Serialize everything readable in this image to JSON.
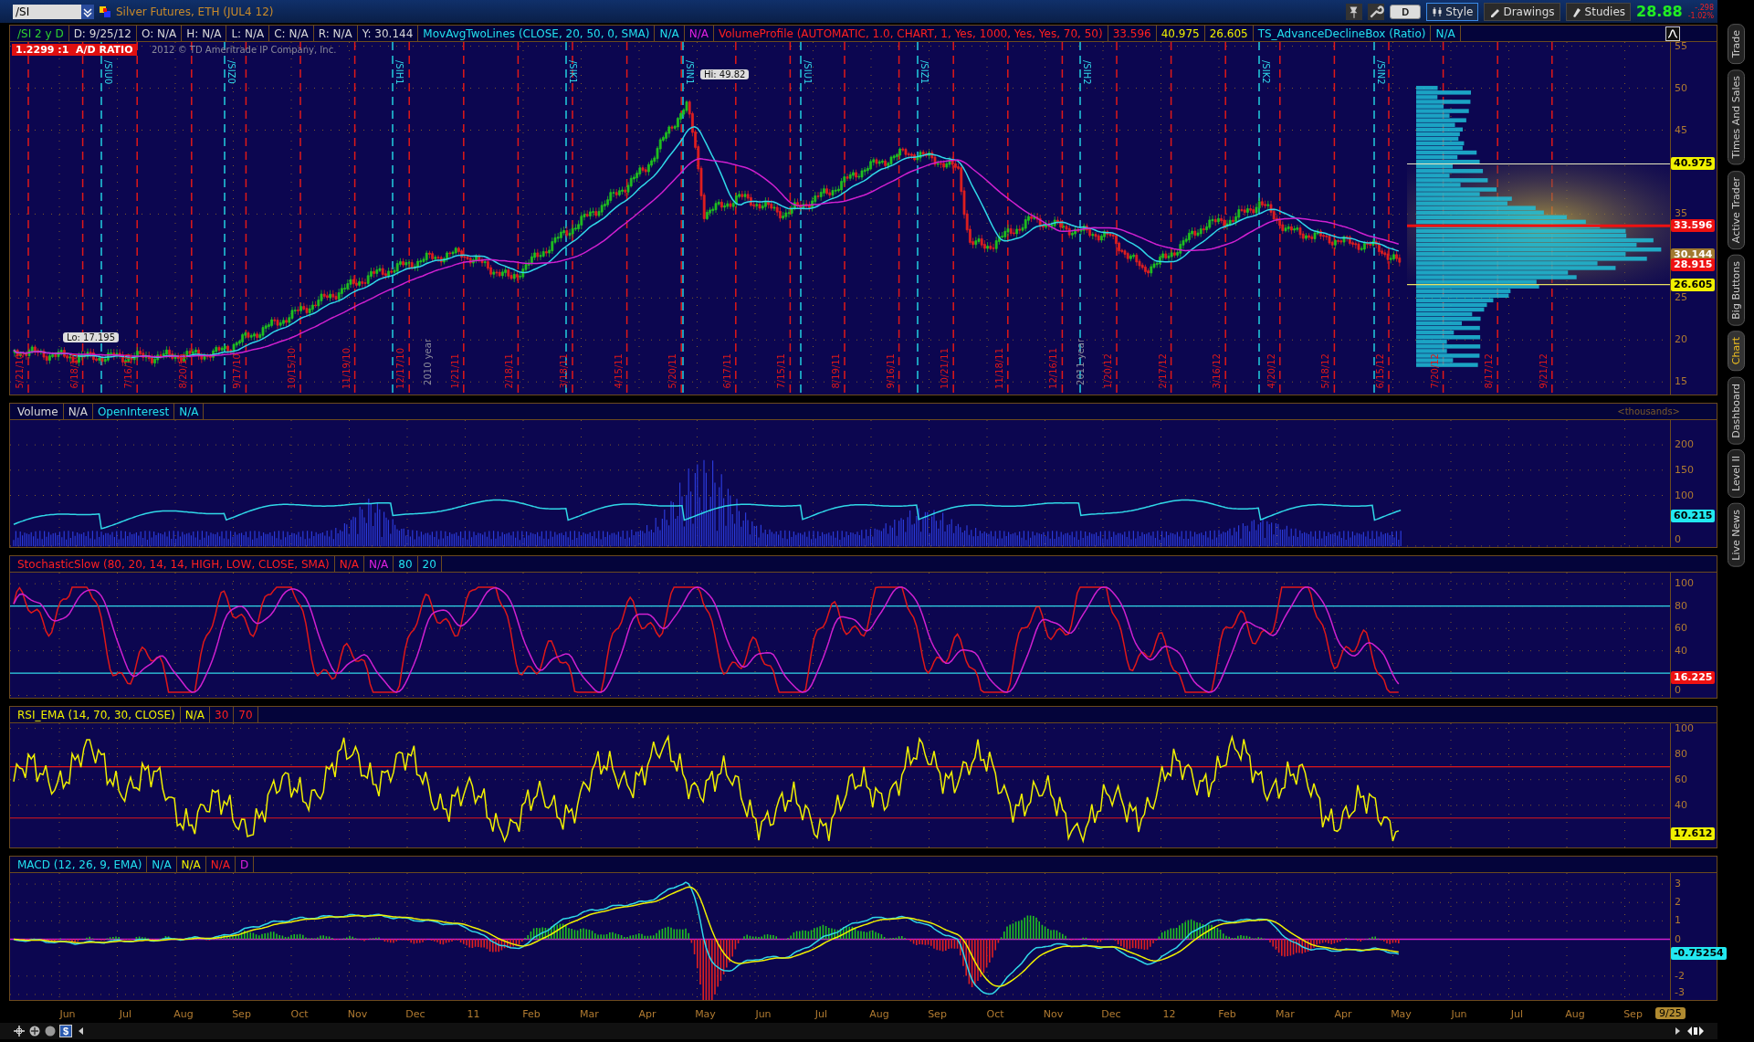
{
  "top_bar": {
    "symbol": "/SI",
    "title": "Silver Futures, ETH (JUL4 12)",
    "buttons": [
      {
        "label": "D",
        "kind": "toggle"
      },
      {
        "label": "Style",
        "kind": "style",
        "selected": true
      },
      {
        "label": "Drawings",
        "kind": "drawings",
        "selected": false
      },
      {
        "label": "Studies",
        "kind": "studies",
        "selected": false
      }
    ],
    "last_price": "28.88",
    "net_change": "-.298",
    "percent_change": "-1.02%"
  },
  "panels": [
    {
      "kind": "price",
      "header": [
        {
          "text": "/SI 2 y D",
          "color": "#2fd12f"
        },
        {
          "text": "D: 9/25/12",
          "color": "#d8d8d8"
        },
        {
          "text": "O: N/A",
          "color": "#d8d8d8"
        },
        {
          "text": "H: N/A",
          "color": "#d8d8d8"
        },
        {
          "text": "L: N/A",
          "color": "#d8d8d8"
        },
        {
          "text": "C: N/A",
          "color": "#d8d8d8"
        },
        {
          "text": "R: N/A",
          "color": "#d8d8d8"
        },
        {
          "text": "Y: 30.144",
          "color": "#d8d8d8"
        },
        {
          "text": "MovAvgTwoLines (CLOSE, 20, 50, 0, SMA)",
          "color": "#22e0ee"
        },
        {
          "text": "N/A",
          "color": "#22e0ee"
        },
        {
          "text": "N/A",
          "color": "#e020e0"
        },
        {
          "text": "VolumeProfile (AUTOMATIC, 1.0, CHART, 1, Yes, 1000, Yes, Yes, 70, 50)",
          "color": "#ff2020"
        },
        {
          "text": "33.596",
          "color": "#ff2020"
        },
        {
          "text": "40.975",
          "color": "#f0f000"
        },
        {
          "text": "26.605",
          "color": "#f0f000"
        },
        {
          "text": "TS_AdvanceDeclineBox (Ratio)",
          "color": "#22e0ee"
        },
        {
          "text": "N/A",
          "color": "#22e0ee"
        }
      ],
      "ad_ratio": "1.2299 :1  A/D RATIO",
      "copyright": "2012 © TD Ameritrade IP Company, Inc.",
      "hi_label": "Hi: 49.82",
      "lo_label": "Lo: 17.195",
      "contract_labels": [
        "/SIU0",
        "/SIZ0",
        "/SIH1",
        "/SIK1",
        "/SIN1",
        "/SIU1",
        "/SIZ1",
        "/SIH2",
        "/SIK2",
        "/SIN2"
      ],
      "date_labels": [
        {
          "text": "5/21/10",
          "kind": "date"
        },
        {
          "text": "6/18/10",
          "kind": "date"
        },
        {
          "text": "7/16/10",
          "kind": "date"
        },
        {
          "text": "8/20/10",
          "kind": "date"
        },
        {
          "text": "9/17/10",
          "kind": "date"
        },
        {
          "text": "10/15/10",
          "kind": "date"
        },
        {
          "text": "11/19/10",
          "kind": "date"
        },
        {
          "text": "12/17/10",
          "kind": "date"
        },
        {
          "text": "2010 year",
          "kind": "year"
        },
        {
          "text": "1/21/11",
          "kind": "date"
        },
        {
          "text": "2/18/11",
          "kind": "date"
        },
        {
          "text": "3/18/11",
          "kind": "date"
        },
        {
          "text": "4/15/11",
          "kind": "date"
        },
        {
          "text": "5/20/11",
          "kind": "date"
        },
        {
          "text": "6/17/11",
          "kind": "date"
        },
        {
          "text": "7/15/11",
          "kind": "date"
        },
        {
          "text": "8/19/11",
          "kind": "date"
        },
        {
          "text": "9/16/11",
          "kind": "date"
        },
        {
          "text": "10/21/11",
          "kind": "date"
        },
        {
          "text": "11/18/11",
          "kind": "date"
        },
        {
          "text": "12/16/11",
          "kind": "date"
        },
        {
          "text": "2011 year",
          "kind": "year"
        },
        {
          "text": "1/20/12",
          "kind": "date"
        },
        {
          "text": "2/17/12",
          "kind": "date"
        },
        {
          "text": "3/16/12",
          "kind": "date"
        },
        {
          "text": "4/20/12",
          "kind": "date"
        },
        {
          "text": "5/18/12",
          "kind": "date"
        },
        {
          "text": "6/15/12",
          "kind": "date"
        },
        {
          "text": "7/20/12",
          "kind": "date"
        },
        {
          "text": "8/17/12",
          "kind": "date"
        },
        {
          "text": "9/21/12",
          "kind": "date"
        }
      ],
      "ticks": [
        "55",
        "50",
        "45",
        "35",
        "25",
        "20",
        "15"
      ],
      "badges": [
        {
          "text": "40.975",
          "color": "#f0f000"
        },
        {
          "text": "33.596",
          "color": "#ee1111"
        },
        {
          "text": "30.144",
          "color": "#a07a30"
        },
        {
          "text": "28.915",
          "color": "#ee1111"
        },
        {
          "text": "26.605",
          "color": "#f0f000"
        }
      ]
    },
    {
      "kind": "volume",
      "header": [
        {
          "text": "Volume",
          "color": "#d8d8d8"
        },
        {
          "text": "N/A",
          "color": "#d8d8d8"
        },
        {
          "text": "OpenInterest",
          "color": "#22e0ee"
        },
        {
          "text": "N/A",
          "color": "#22e0ee"
        }
      ],
      "header_note": "<thousands>",
      "ticks": [
        "200",
        "150",
        "100",
        "0"
      ],
      "badges": [
        {
          "text": "60.215",
          "color": "#22e8f0"
        }
      ]
    },
    {
      "kind": "stochastic",
      "header": [
        {
          "text": "StochasticSlow (80, 20, 14, 14, HIGH, LOW, CLOSE, SMA)",
          "color": "#ff2020"
        },
        {
          "text": "N/A",
          "color": "#ff2020"
        },
        {
          "text": "N/A",
          "color": "#e020e0"
        },
        {
          "text": "80",
          "color": "#22e0ee"
        },
        {
          "text": "20",
          "color": "#22e0ee"
        }
      ],
      "ticks": [
        "100",
        "80",
        "60",
        "40",
        "0"
      ],
      "badges": [
        {
          "text": "16.225",
          "color": "#ee1111"
        }
      ]
    },
    {
      "kind": "rsi",
      "header": [
        {
          "text": "RSI_EMA (14, 70, 30, CLOSE)",
          "color": "#f0f000"
        },
        {
          "text": "N/A",
          "color": "#f0f000"
        },
        {
          "text": "30",
          "color": "#ff2020"
        },
        {
          "text": "70",
          "color": "#ff2020"
        }
      ],
      "ticks": [
        "100",
        "80",
        "60",
        "40"
      ],
      "badges": [
        {
          "text": "17.612",
          "color": "#f0f000"
        }
      ]
    },
    {
      "kind": "macd",
      "header": [
        {
          "text": "MACD (12, 26, 9, EMA)",
          "color": "#22e0ee"
        },
        {
          "text": "N/A",
          "color": "#22e0ee"
        },
        {
          "text": "N/A",
          "color": "#f0f000"
        },
        {
          "text": "N/A",
          "color": "#ff2020"
        },
        {
          "text": "D",
          "color": "#e020e0"
        }
      ],
      "ticks": [
        "3",
        "2",
        "1",
        "0",
        "-2",
        "-3"
      ],
      "badges": [
        {
          "text": "-0.75254",
          "color": "#22e8f0"
        }
      ]
    }
  ],
  "time_axis": {
    "months": [
      "Jun",
      "Jul",
      "Aug",
      "Sep",
      "Oct",
      "Nov",
      "Dec",
      "11",
      "Feb",
      "Mar",
      "Apr",
      "May",
      "Jun",
      "Jul",
      "Aug",
      "Sep",
      "Oct",
      "Nov",
      "Dec",
      "12",
      "Feb",
      "Mar",
      "Apr",
      "May",
      "Jun",
      "Jul",
      "Aug",
      "Sep"
    ],
    "end_badge": "9/25"
  },
  "bottom_toolbar": {
    "currency_button": "$"
  },
  "side_tabs": [
    {
      "label": "Trade",
      "selected": false
    },
    {
      "label": "Times And Sales",
      "selected": false
    },
    {
      "label": "Active Trader",
      "selected": false
    },
    {
      "label": "Big Buttons",
      "selected": false
    },
    {
      "label": "Chart",
      "selected": true
    },
    {
      "label": "Dashboard",
      "selected": false
    },
    {
      "label": "Level II",
      "selected": false
    },
    {
      "label": "Live News",
      "selected": false
    }
  ]
}
